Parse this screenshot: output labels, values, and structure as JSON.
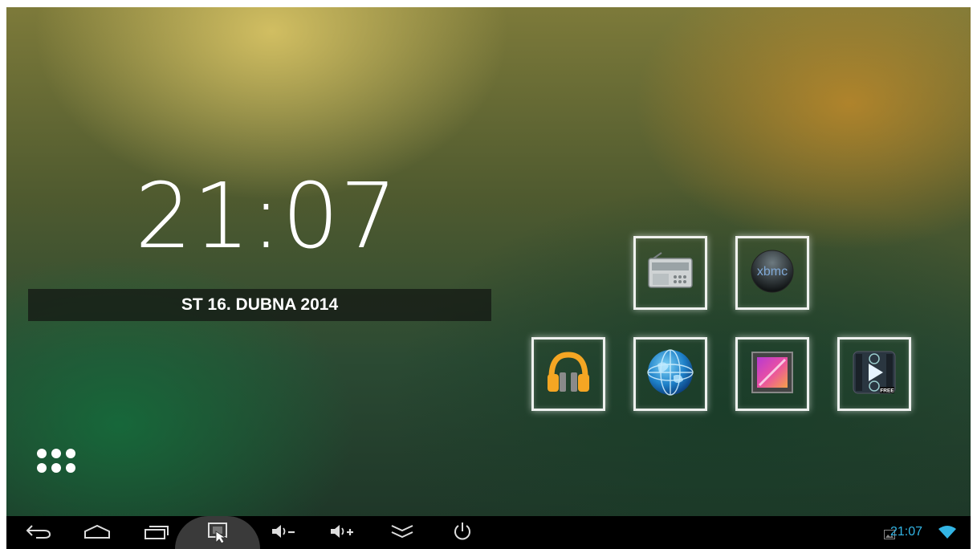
{
  "clock": {
    "time": "21:07",
    "date": "ST 16. DUBNA 2014"
  },
  "launcher": {
    "apps_icon": "all-apps-grid-icon"
  },
  "tiles": [
    {
      "name": "radio-app-tile",
      "icon": "radio-icon"
    },
    {
      "name": "xbmc-app-tile",
      "icon": "xbmc-logo-icon",
      "logo_text": "xbmc"
    },
    {
      "name": "play-music-app-tile",
      "icon": "headphones-icon"
    },
    {
      "name": "browser-app-tile",
      "icon": "globe-icon"
    },
    {
      "name": "gallery-app-tile",
      "icon": "gallery-icon"
    },
    {
      "name": "video-player-app-tile",
      "icon": "video-play-icon",
      "badge": "FREE"
    }
  ],
  "navbar": {
    "buttons": [
      "back-icon",
      "home-icon",
      "recent-apps-icon",
      "screenshot-icon",
      "volume-down-icon",
      "volume-up-icon",
      "collapse-icon",
      "power-icon"
    ],
    "status_time": "21:07",
    "status_icons": [
      "image-notification-icon",
      "wifi-icon"
    ],
    "accent": "#33b5e5"
  }
}
